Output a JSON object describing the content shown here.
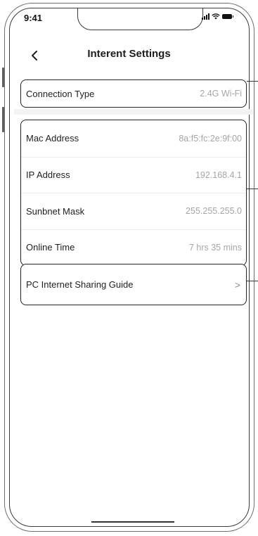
{
  "status_bar": {
    "time": "9:41"
  },
  "header": {
    "title": "Interent Settings"
  },
  "connection_card": {
    "rows": [
      {
        "label": "Connection Type",
        "value": "2.4G Wi-Fi"
      }
    ]
  },
  "details_card": {
    "rows": [
      {
        "label": "Mac Address",
        "value": "8a:f5:fc:2e:9f:00"
      },
      {
        "label": "IP Address",
        "value": "192.168.4.1"
      },
      {
        "label": "Sunbnet Mask",
        "value": "255.255.255.0"
      },
      {
        "label": "Online Time",
        "value": "7 hrs 35 mins"
      }
    ]
  },
  "guide_card": {
    "label": "PC Internet Sharing Guide",
    "chevron": ">"
  },
  "colors": {
    "label": "#1f1f1f",
    "value": "#a6a6a6",
    "border": "#222222"
  }
}
